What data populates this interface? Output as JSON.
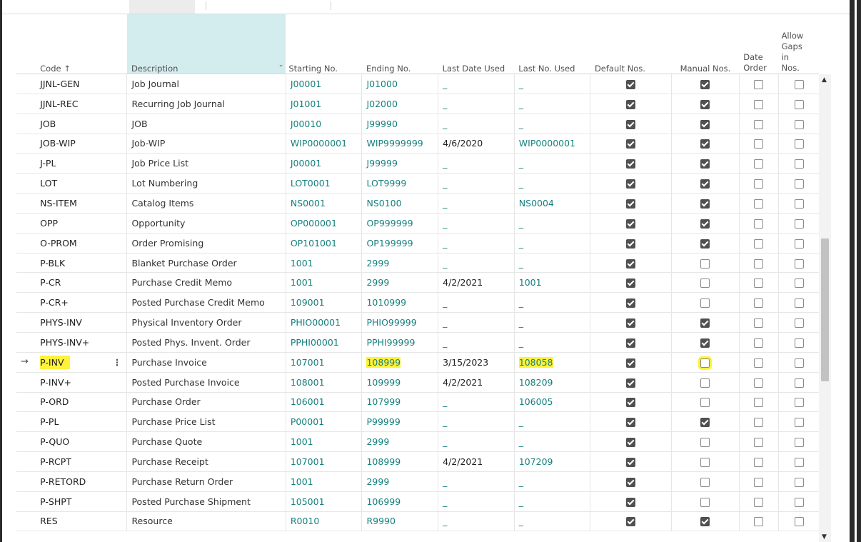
{
  "columns": {
    "code": "Code ↑",
    "description": "Description",
    "starting_no": "Starting No.",
    "ending_no": "Ending No.",
    "last_date_used": "Last Date Used",
    "last_no_used": "Last No. Used",
    "default_nos": "Default Nos.",
    "manual_nos": "Manual Nos.",
    "date_order": "Date Order",
    "allow_gaps": "Allow Gaps in Nos."
  },
  "rows": [
    {
      "code": "JJNL-GEN",
      "desc": "Job Journal",
      "start": "J00001",
      "end": "J01000",
      "date": "_",
      "last": "_",
      "def": true,
      "man": true,
      "ord": false,
      "gap": false
    },
    {
      "code": "JJNL-REC",
      "desc": "Recurring Job Journal",
      "start": "J01001",
      "end": "J02000",
      "date": "_",
      "last": "_",
      "def": true,
      "man": true,
      "ord": false,
      "gap": false
    },
    {
      "code": "JOB",
      "desc": "JOB",
      "start": "J00010",
      "end": "J99990",
      "date": "_",
      "last": "_",
      "def": true,
      "man": true,
      "ord": false,
      "gap": false
    },
    {
      "code": "JOB-WIP",
      "desc": "Job-WIP",
      "start": "WIP0000001",
      "end": "WIP9999999",
      "date": "4/6/2020",
      "last": "WIP0000001",
      "def": true,
      "man": true,
      "ord": false,
      "gap": false
    },
    {
      "code": "J-PL",
      "desc": "Job Price List",
      "start": "J00001",
      "end": "J99999",
      "date": "_",
      "last": "_",
      "def": true,
      "man": true,
      "ord": false,
      "gap": false
    },
    {
      "code": "LOT",
      "desc": "Lot Numbering",
      "start": "LOT0001",
      "end": "LOT9999",
      "date": "_",
      "last": "_",
      "def": true,
      "man": true,
      "ord": false,
      "gap": false
    },
    {
      "code": "NS-ITEM",
      "desc": "Catalog Items",
      "start": "NS0001",
      "end": "NS0100",
      "date": "_",
      "last": "NS0004",
      "def": true,
      "man": true,
      "ord": false,
      "gap": false
    },
    {
      "code": "OPP",
      "desc": "Opportunity",
      "start": "OP000001",
      "end": "OP999999",
      "date": "_",
      "last": "_",
      "def": true,
      "man": true,
      "ord": false,
      "gap": false
    },
    {
      "code": "O-PROM",
      "desc": "Order Promising",
      "start": "OP101001",
      "end": "OP199999",
      "date": "_",
      "last": "_",
      "def": true,
      "man": true,
      "ord": false,
      "gap": false
    },
    {
      "code": "P-BLK",
      "desc": "Blanket Purchase Order",
      "start": "1001",
      "end": "2999",
      "date": "_",
      "last": "_",
      "def": true,
      "man": false,
      "ord": false,
      "gap": false
    },
    {
      "code": "P-CR",
      "desc": "Purchase Credit Memo",
      "start": "1001",
      "end": "2999",
      "date": "4/2/2021",
      "last": "1001",
      "def": true,
      "man": false,
      "ord": false,
      "gap": false
    },
    {
      "code": "P-CR+",
      "desc": "Posted Purchase Credit Memo",
      "start": "109001",
      "end": "1010999",
      "date": "_",
      "last": "_",
      "def": true,
      "man": false,
      "ord": false,
      "gap": false
    },
    {
      "code": "PHYS-INV",
      "desc": "Physical Inventory Order",
      "start": "PHIO00001",
      "end": "PHIO99999",
      "date": "_",
      "last": "_",
      "def": true,
      "man": true,
      "ord": false,
      "gap": false
    },
    {
      "code": "PHYS-INV+",
      "desc": "Posted Phys. Invent. Order",
      "start": "PPHI00001",
      "end": "PPHI99999",
      "date": "_",
      "last": "_",
      "def": true,
      "man": true,
      "ord": false,
      "gap": false
    },
    {
      "code": "P-INV",
      "desc": "Purchase Invoice",
      "start": "107001",
      "end": "108999",
      "date": "3/15/2023",
      "last": "108058",
      "def": true,
      "man": false,
      "ord": false,
      "gap": false,
      "current": true
    },
    {
      "code": "P-INV+",
      "desc": "Posted Purchase Invoice",
      "start": "108001",
      "end": "109999",
      "date": "4/2/2021",
      "last": "108209",
      "def": true,
      "man": false,
      "ord": false,
      "gap": false
    },
    {
      "code": "P-ORD",
      "desc": "Purchase Order",
      "start": "106001",
      "end": "107999",
      "date": "_",
      "last": "106005",
      "def": true,
      "man": false,
      "ord": false,
      "gap": false
    },
    {
      "code": "P-PL",
      "desc": "Purchase Price List",
      "start": "P00001",
      "end": "P99999",
      "date": "_",
      "last": "_",
      "def": true,
      "man": true,
      "ord": false,
      "gap": false
    },
    {
      "code": "P-QUO",
      "desc": "Purchase Quote",
      "start": "1001",
      "end": "2999",
      "date": "_",
      "last": "_",
      "def": true,
      "man": false,
      "ord": false,
      "gap": false
    },
    {
      "code": "P-RCPT",
      "desc": "Purchase Receipt",
      "start": "107001",
      "end": "108999",
      "date": "4/2/2021",
      "last": "107209",
      "def": true,
      "man": false,
      "ord": false,
      "gap": false
    },
    {
      "code": "P-RETORD",
      "desc": "Purchase Return Order",
      "start": "1001",
      "end": "2999",
      "date": "_",
      "last": "_",
      "def": true,
      "man": false,
      "ord": false,
      "gap": false
    },
    {
      "code": "P-SHPT",
      "desc": "Posted Purchase Shipment",
      "start": "105001",
      "end": "106999",
      "date": "_",
      "last": "_",
      "def": true,
      "man": false,
      "ord": false,
      "gap": false
    },
    {
      "code": "RES",
      "desc": "Resource",
      "start": "R0010",
      "end": "R9990",
      "date": "_",
      "last": "_",
      "def": true,
      "man": true,
      "ord": false,
      "gap": false
    }
  ],
  "colors": {
    "link": "#16807d",
    "highlight": "#fff23a",
    "sorted_column_bg": "#d3ecee"
  },
  "icons": {
    "row_arrow": "→",
    "row_menu": "⋮",
    "sort_dropdown": "⌄",
    "scroll_up": "▲",
    "scroll_down": "▼"
  }
}
